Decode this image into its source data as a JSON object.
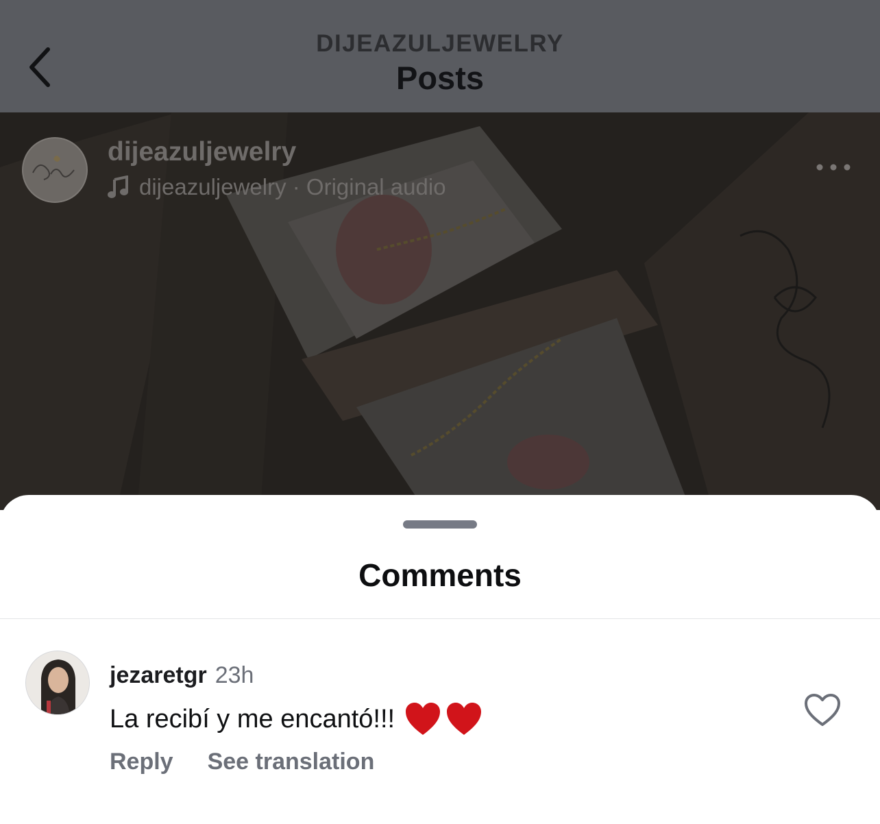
{
  "header": {
    "subtitle": "DIJEAZULJEWELRY",
    "title": "Posts"
  },
  "post": {
    "username": "dijeazuljewelry",
    "audio": "dijeazuljewelry · Original audio"
  },
  "sheet": {
    "title": "Comments"
  },
  "comments": [
    {
      "username": "jezaretgr",
      "time": "23h",
      "text": "La recibí y me encantó!!!",
      "reply_label": "Reply",
      "translate_label": "See translation"
    }
  ],
  "colors": {
    "header_bg": "#595b60",
    "heart_red": "#d1141a",
    "secondary_text": "#6b6f78"
  }
}
